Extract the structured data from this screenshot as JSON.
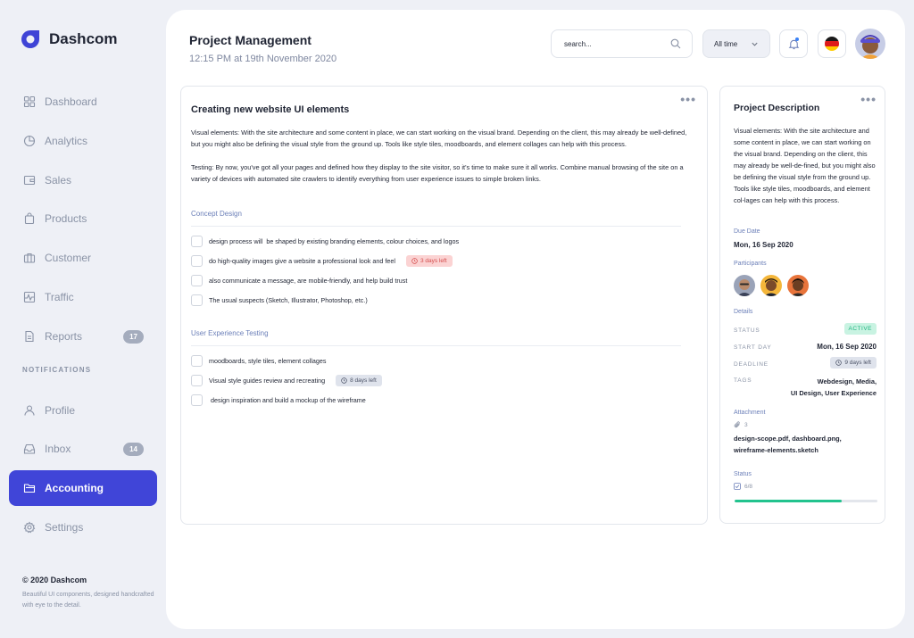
{
  "brand": {
    "name": "Dashcom"
  },
  "nav": {
    "items": [
      {
        "label": "Dashboard",
        "icon": "grid-icon"
      },
      {
        "label": "Analytics",
        "icon": "pie-chart-icon"
      },
      {
        "label": "Sales",
        "icon": "wallet-icon"
      },
      {
        "label": "Products",
        "icon": "shopping-bag-icon"
      },
      {
        "label": "Customer",
        "icon": "briefcase-icon"
      },
      {
        "label": "Traffic",
        "icon": "activity-icon"
      },
      {
        "label": "Reports",
        "icon": "document-icon",
        "badge": "17"
      }
    ],
    "section_label": "NOTIFICATIONS",
    "items2": [
      {
        "label": "Profile",
        "icon": "user-icon"
      },
      {
        "label": "Inbox",
        "icon": "inbox-icon",
        "badge": "14"
      },
      {
        "label": "Accounting",
        "icon": "folder-icon",
        "active": true
      },
      {
        "label": "Settings",
        "icon": "gear-icon"
      }
    ]
  },
  "footer": {
    "copyright": "© 2020 Dashcom",
    "note": "Beautiful UI components, designed handcrafted with eye to the detail."
  },
  "header": {
    "title": "Project Management",
    "subtitle": "12:15 PM at 19th November 2020",
    "search_placeholder": "search...",
    "filter_label": "All time"
  },
  "task": {
    "title": "Creating new website UI elements",
    "paragraphs": [
      "Visual elements: With the site architecture and some content in place, we can start working on the visual brand. Depending on the client, this may already be well-defined, but you might also be defining the visual style from the ground up. Tools like style tiles, moodboards, and element collages can help with this process.",
      "Testing: By now, you've got all your pages and defined how they display to the site visitor, so it's time to make sure it all works. Combine manual browsing of the site on a variety of devices with automated site crawlers to identify everything from user experience issues to simple broken links."
    ],
    "sections": [
      {
        "label": "Concept Design",
        "items": [
          {
            "text": "design process will  be shaped by existing branding elements, colour choices, and logos"
          },
          {
            "text": "do high-quality images give a website a professional look and feel",
            "tag": "3 days left",
            "tag_style": "red"
          },
          {
            "text": "also communicate a message, are mobile-friendly, and help build trust"
          },
          {
            "text": "The usual suspects (Sketch, Illustrator, Photoshop, etc.)"
          }
        ]
      },
      {
        "label": "User Experience Testing",
        "items": [
          {
            "text": "moodboards, style tiles, element collages"
          },
          {
            "text": "Visual style guides review and recreating",
            "tag": "8 days left",
            "tag_style": "gray"
          },
          {
            "text": " design inspiration and build a mockup of the wireframe"
          }
        ]
      }
    ]
  },
  "description": {
    "title": "Project Description",
    "text": "Visual elements: With the site architecture and some content in place, we can start working on the visual brand. Depending on the client, this may already be well-de-fined, but you might also be defining the visual style from the ground up. Tools like style tiles, moodboards, and element col-lages can help with this process.",
    "due_date_label": "Due Date",
    "due_date": "Mon, 16 Sep 2020",
    "participants_label": "Participants",
    "details_label": "Details",
    "status_key": "STATUS",
    "status_value": "ACTIVE",
    "start_day_key": "START DAY",
    "start_day_value": "Mon, 16 Sep 2020",
    "deadline_key": "DEADLINE",
    "deadline_value": "9 days left",
    "tags_key": "TAGS",
    "tags_line1": "Webdesign, Media,",
    "tags_line2": "UI Design, User Experience",
    "attachment_label": "Attachment",
    "attachment_count": "3",
    "files_line1": "design-scope.pdf, dashboard.png,",
    "files_line2": "wireframe-elements.sketch",
    "status_label": "Status",
    "status_count": "6/8",
    "progress_fraction": 0.75
  },
  "colors": {
    "accent": "#4045d8",
    "success": "#22c38e",
    "danger": "#d44b4b",
    "muted": "#8a93a6"
  }
}
